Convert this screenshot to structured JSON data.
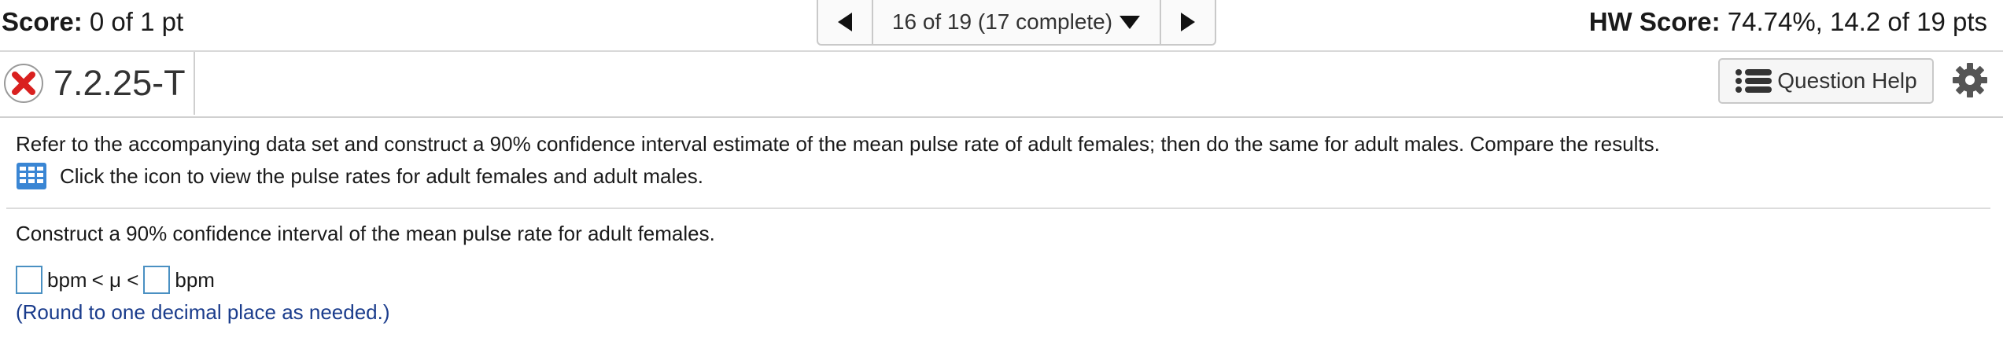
{
  "topbar": {
    "score_label": "Score:",
    "score_value": " 0 of 1 pt",
    "nav_text": "16 of 19 (17 complete)",
    "hw_label": "HW Score:",
    "hw_value": " 74.74%, 14.2 of 19 pts"
  },
  "question": {
    "id": "7.2.25-T",
    "help_label": "Question Help",
    "prompt": "Refer to the accompanying data set and construct a 90% confidence interval estimate of the mean pulse rate of adult females; then do the same for adult males. Compare the results.",
    "data_link": "Click the icon to view the pulse rates for adult females and adult males.",
    "part_text": "Construct a 90% confidence interval of the mean pulse rate for adult females.",
    "unit_left": "bpm",
    "inequality": "< μ <",
    "unit_right": "bpm",
    "hint": "(Round to one decimal place as needed.)"
  },
  "colors": {
    "incorrect": "#d9201f",
    "input_border": "#4a90c2",
    "hint_text": "#1a3c8c",
    "grid_icon": "#3a86d4"
  },
  "icons": [
    "previous-arrow-icon",
    "dropdown-triangle-icon",
    "next-arrow-icon",
    "incorrect-x-icon",
    "list-icon",
    "gear-icon",
    "data-table-icon"
  ]
}
